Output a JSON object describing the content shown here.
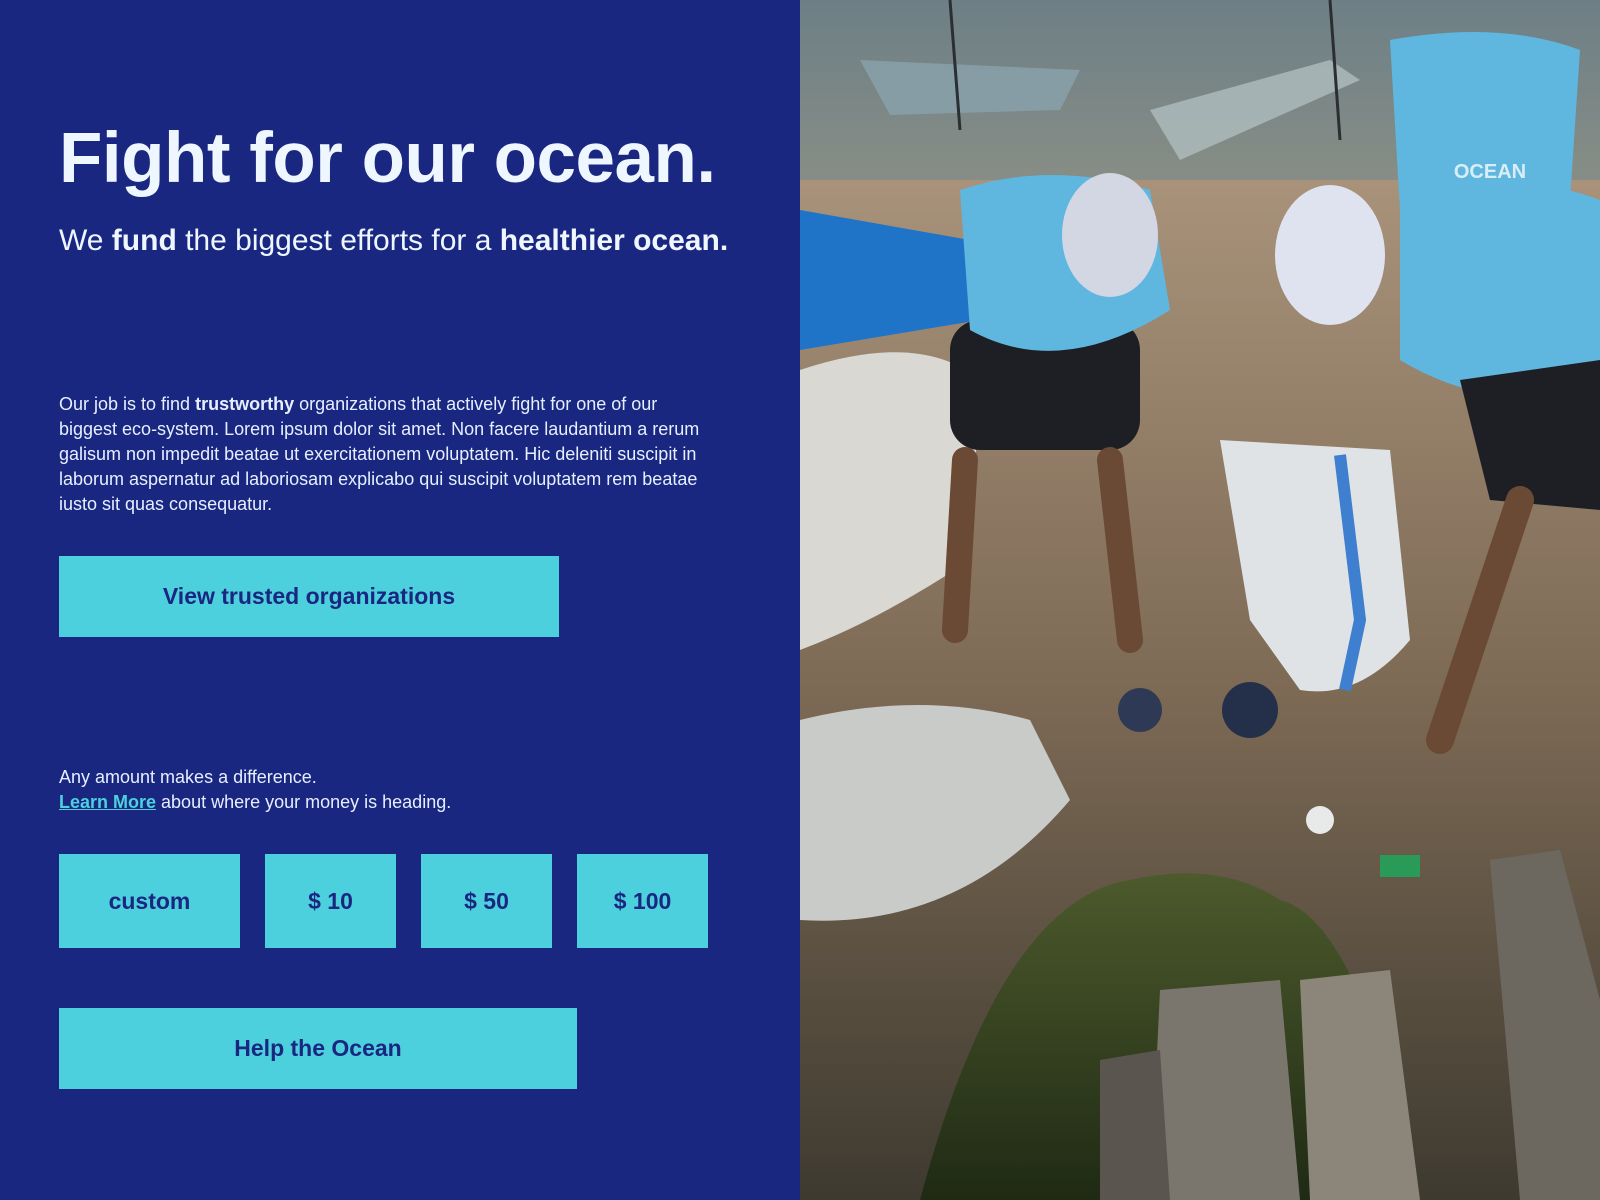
{
  "hero": {
    "title": "Fight for our ocean.",
    "subtitle_parts": [
      "We ",
      "fund",
      " the biggest efforts for a ",
      "healthier ocean."
    ]
  },
  "intro": {
    "text_parts": [
      "Our job is to find ",
      "trustworthy",
      " organizations that actively fight for one of our biggest eco-system. Lorem ipsum dolor sit amet. Non facere laudantium a rerum galisum non impedit beatae ut exercitationem voluptatem. Hic deleniti suscipit in laborum aspernatur ad laboriosam explicabo qui suscipit voluptatem rem beatae iusto sit quas consequatur."
    ]
  },
  "view_button": {
    "label": "View trusted organizations"
  },
  "donation": {
    "line1": "Any amount makes a difference.",
    "learn_more": "Learn More",
    "line2_rest": " about where your money is heading.",
    "amounts": [
      "custom",
      "$ 10",
      "$ 50",
      "$ 100"
    ]
  },
  "help_button": {
    "label": "Help the Ocean"
  },
  "colors": {
    "background": "#1a2780",
    "accent": "#4dd0dd",
    "text": "#eef6ff"
  },
  "photo": {
    "tshirt_text": "OCEAN"
  }
}
